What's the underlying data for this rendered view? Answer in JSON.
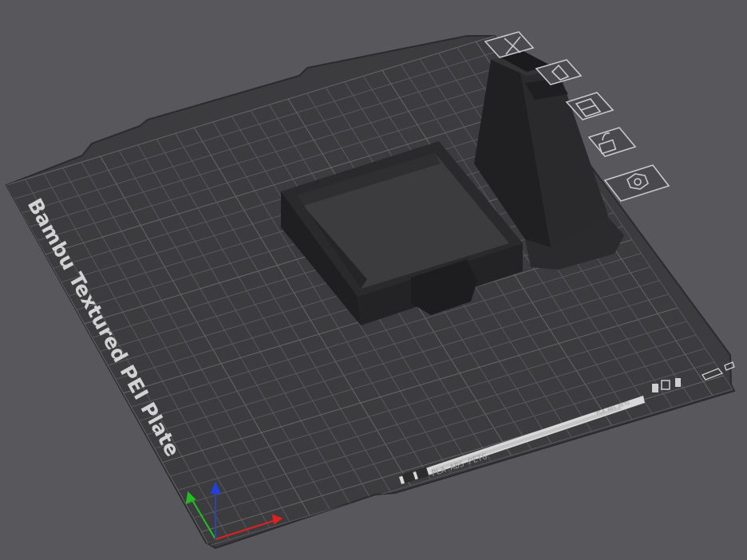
{
  "viewport": {
    "background": "#57575c"
  },
  "plate": {
    "label": "Bambu Textured PEI Plate",
    "surface_color": "#3b3b3e",
    "grid_color": "#5a5a5e",
    "filament_info": "PLA ABS PETG",
    "filament_info_secondary": "PLA ABS PETG"
  },
  "plate_toolbar": {
    "items": [
      {
        "name": "delete-plate",
        "icon": "close-icon"
      },
      {
        "name": "arrange",
        "icon": "arrange-icon"
      },
      {
        "name": "orient",
        "icon": "orient-icon"
      },
      {
        "name": "lock-plate",
        "icon": "lock-icon"
      },
      {
        "name": "plate-settings",
        "icon": "settings-hex-icon"
      }
    ]
  },
  "axes": {
    "x_color": "#e02020",
    "y_color": "#20c020",
    "z_color": "#2040e0"
  },
  "objects": [
    {
      "name": "square-frame-box"
    },
    {
      "name": "tapered-tower"
    }
  ]
}
